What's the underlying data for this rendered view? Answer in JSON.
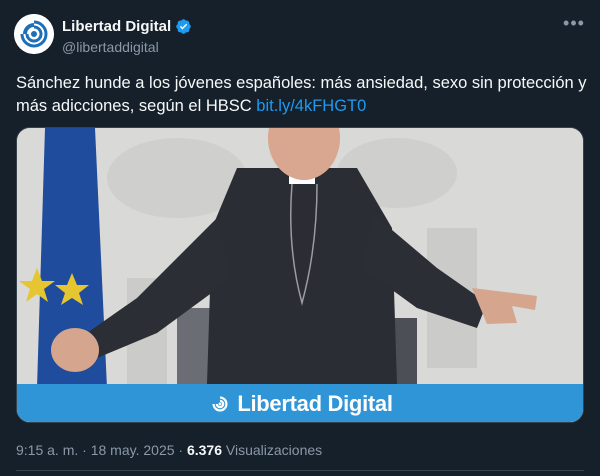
{
  "author": {
    "name": "Libertad Digital",
    "handle": "@libertaddigital",
    "avatar_icon": "libertad-digital-logo",
    "verified_icon": "verified-badge-icon",
    "verified_color": "#1d9bf0"
  },
  "more_icon": "more-options-icon",
  "tweet": {
    "text": "Sánchez hunde a los jóvenes españoles: más ansiedad, sexo sin protección y más adicciones, según el HBSC ",
    "link": "bit.ly/4kFHGT0"
  },
  "media": {
    "banner_text": "Libertad Digital",
    "banner_color": "#2f95d6",
    "banner_icon": "libertad-digital-logo"
  },
  "meta": {
    "time": "9:15 a. m.",
    "separator": " · ",
    "date": "18 may. 2025",
    "views_count": "6.376",
    "views_label": " Visualizaciones"
  },
  "colors": {
    "background": "#15202b",
    "text": "#f7f9f9",
    "secondary_text": "#8b98a5",
    "link": "#1d9bf0"
  }
}
